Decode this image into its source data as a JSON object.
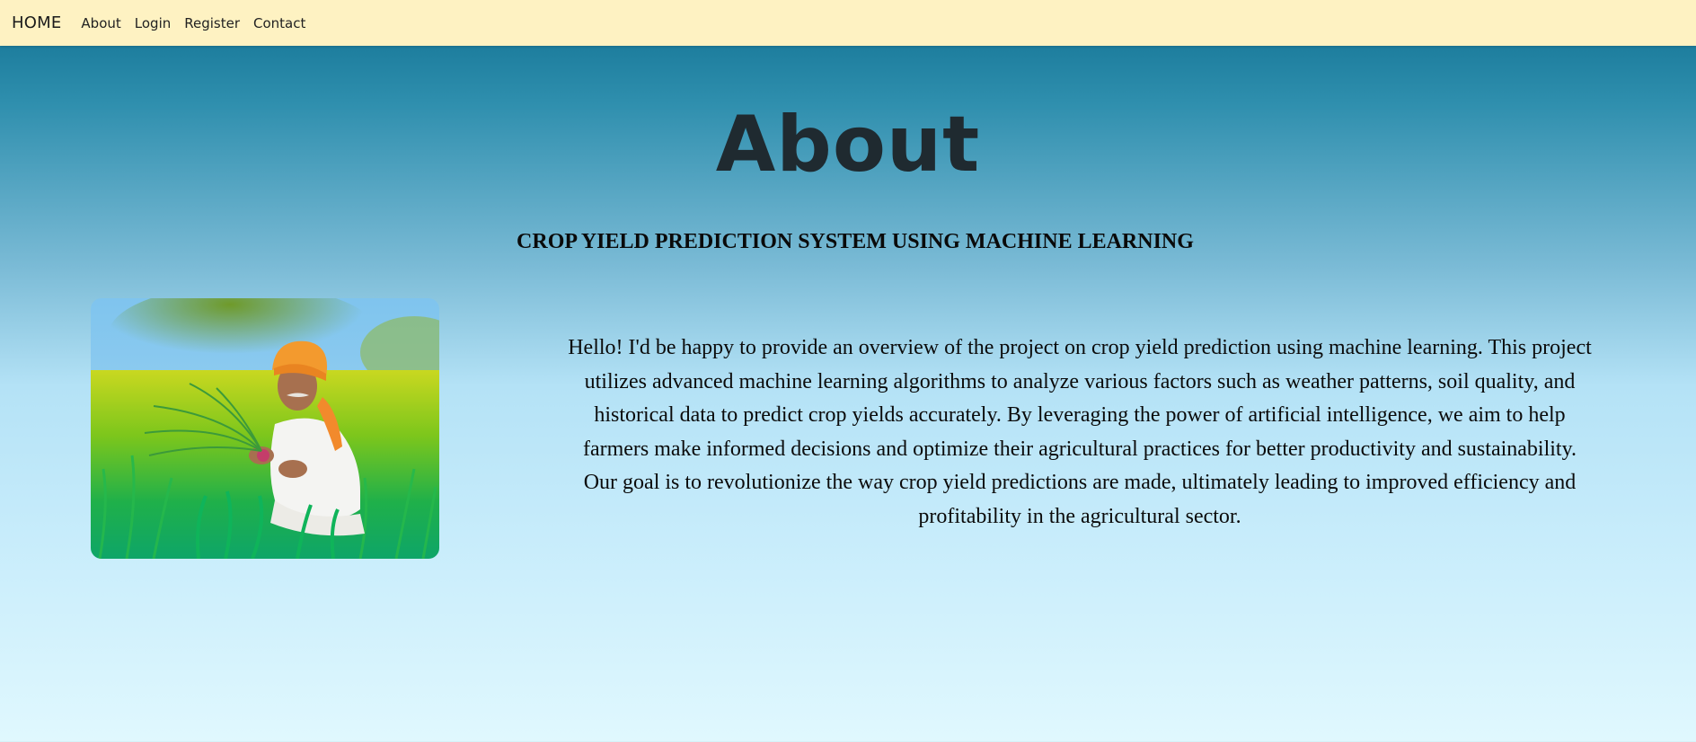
{
  "navbar": {
    "brand": "HOME",
    "links": [
      {
        "label": "About"
      },
      {
        "label": "Login"
      },
      {
        "label": "Register"
      },
      {
        "label": "Contact"
      }
    ]
  },
  "page": {
    "title": "About",
    "subtitle": "CROP YIELD PREDICTION SYSTEM USING MACHINE LEARNING",
    "description": "Hello! I'd be happy to provide an overview of the project on crop yield prediction using machine learning. This project utilizes advanced machine learning algorithms to analyze various factors such as weather patterns, soil quality, and historical data to predict crop yields accurately. By leveraging the power of artificial intelligence, we aim to help farmers make informed decisions and optimize their agricultural practices for better productivity and sustainability. Our goal is to revolutionize the way crop yield predictions are made, ultimately leading to improved efficiency and profitability in the agricultural sector."
  },
  "image": {
    "subject": "farmer-in-field-photo"
  },
  "colors": {
    "navbar_bg": "#fef2c2",
    "gradient_top": "#0f7091",
    "gradient_bottom": "#e0f8fe",
    "title_color": "#1f2a30"
  }
}
